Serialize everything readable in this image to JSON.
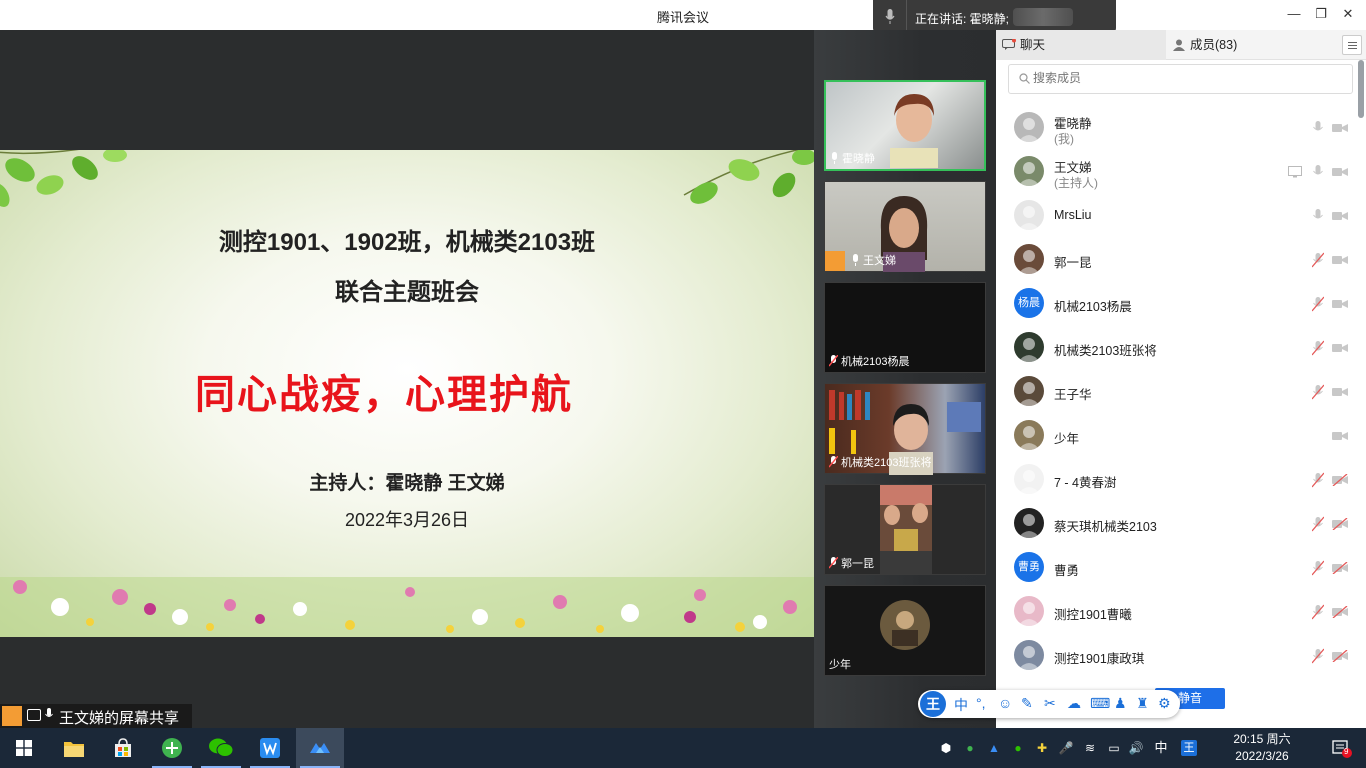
{
  "window": {
    "title": "腾讯会议"
  },
  "speaking": {
    "label": "正在讲话: 霍晓静;"
  },
  "slide": {
    "title_line1": "测控1901、1902班，机械类2103班",
    "title_line2": "联合主题班会",
    "headline": "同心战疫，心理护航",
    "hosts": "主持人：霍晓静 王文娣",
    "date": "2022年3月26日"
  },
  "share_label": "王文娣的屏幕共享",
  "video_tiles": [
    {
      "name": "霍晓静",
      "mic": "on"
    },
    {
      "name": "王文娣",
      "mic": "on"
    },
    {
      "name": "机械2103杨晨",
      "mic": "muted"
    },
    {
      "name": "机械类2103班张将",
      "mic": "muted"
    },
    {
      "name": "郭一昆",
      "mic": "muted"
    },
    {
      "name": "少年",
      "mic": "none"
    }
  ],
  "panel": {
    "tab_chat": "聊天",
    "tab_members": "成员(83)",
    "search_placeholder": "搜索成员",
    "members": [
      {
        "name": "霍晓静",
        "sub": "(我)"
      },
      {
        "name": "王文娣",
        "sub": "(主持人)"
      },
      {
        "name": "MrsLiu",
        "sub": ""
      },
      {
        "name": "郭一昆",
        "sub": ""
      },
      {
        "name": "机械2103杨晨",
        "sub": "",
        "avatar_text": "杨晨"
      },
      {
        "name": "机械类2103班张将",
        "sub": ""
      },
      {
        "name": "王子华",
        "sub": ""
      },
      {
        "name": "少年",
        "sub": ""
      },
      {
        "name": "7 - 4黄春澍",
        "sub": ""
      },
      {
        "name": "蔡天琪机械类2103",
        "sub": ""
      },
      {
        "name": "曹勇",
        "sub": "",
        "avatar_text": "曹勇"
      },
      {
        "name": "测控1901曹曦",
        "sub": ""
      },
      {
        "name": "测控1901康政琪",
        "sub": ""
      }
    ]
  },
  "ime": {
    "logo": "王",
    "mode": "中",
    "punct": "°,"
  },
  "mute_button": "静音",
  "taskbar": {
    "time": "20:15 周六",
    "date": "2022/3/26",
    "ime_lang": "中",
    "notification_count": "9"
  },
  "colors": {
    "accent": "#1e6fe8",
    "active_speaker": "#35c05a",
    "headline": "#e8141b"
  }
}
